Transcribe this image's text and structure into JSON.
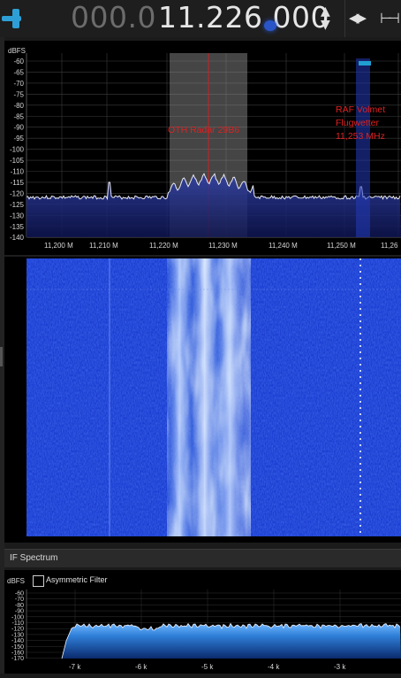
{
  "frequency": {
    "dim_digits": "000.0",
    "main_digits": "11.226.000"
  },
  "controls": {
    "step_up": "▲",
    "step_down": "▼",
    "swap": "◀▶",
    "span": "⊢⊣"
  },
  "spectrum": {
    "unit": "dBFS",
    "y_ticks": [
      "-60",
      "-65",
      "-70",
      "-75",
      "-80",
      "-85",
      "-90",
      "-95",
      "-100",
      "-105",
      "-110",
      "-115",
      "-120",
      "-125",
      "-130",
      "-135",
      "-140"
    ],
    "x_ticks": [
      "11,200 M",
      "11,210 M",
      "11,220 M",
      "11,230 M",
      "11,240 M",
      "11,250 M",
      "11,26"
    ],
    "annotations": {
      "oth": "OTH Radar 29B6",
      "raf_line1": "RAF Volmet",
      "raf_line2": "Flugwetter",
      "raf_line3": "11,253 MHz"
    },
    "annotation_color": "#e02020",
    "trace_color": "#e8e8f0",
    "fill_color": "#1c2a7a"
  },
  "if_spectrum": {
    "title": "IF Spectrum",
    "unit": "dBFS",
    "checkbox_label": "Asymmetric Filter",
    "y_ticks": [
      "-60",
      "-70",
      "-80",
      "-90",
      "-100",
      "-110",
      "-120",
      "-130",
      "-140",
      "-150",
      "-160",
      "-170"
    ],
    "x_ticks": [
      "-7 k",
      "-6 k",
      "-5 k",
      "-4 k",
      "-3 k"
    ]
  },
  "waterfall": {
    "background": "#1a3bd0"
  }
}
